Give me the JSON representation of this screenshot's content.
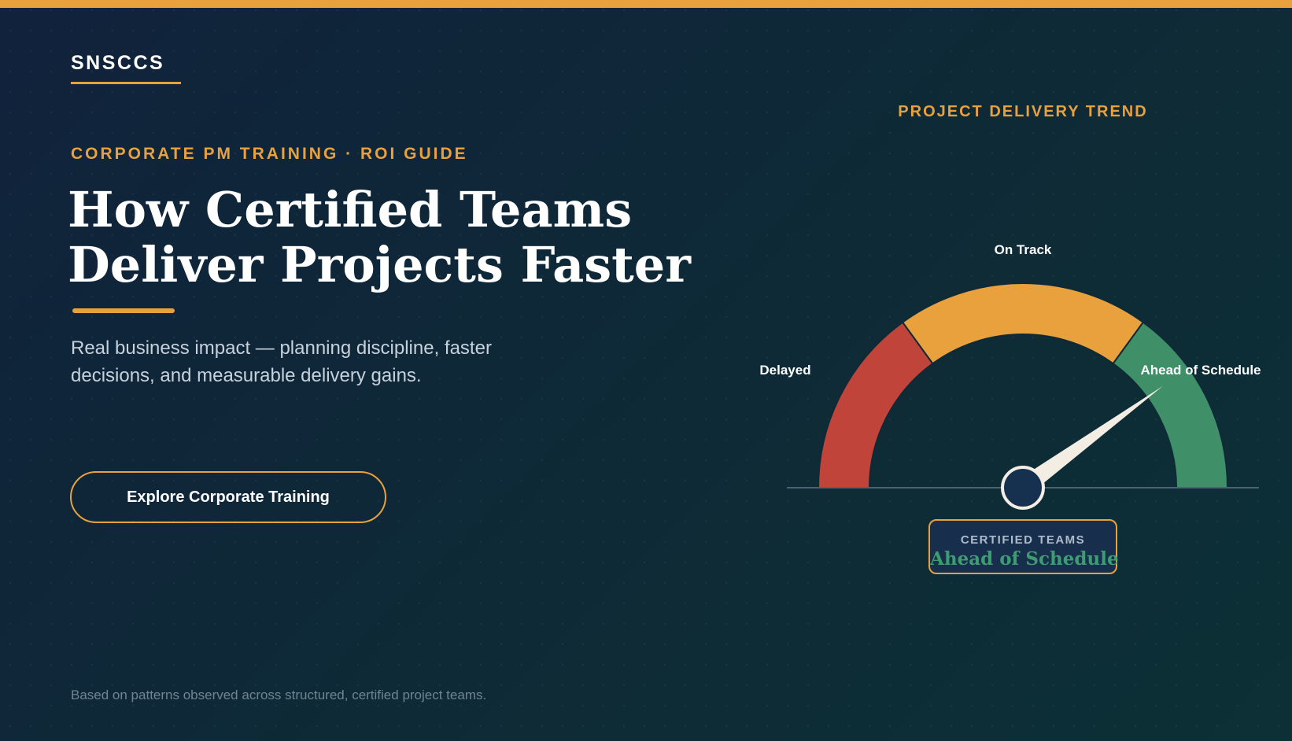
{
  "brand": "SNSCCS",
  "hero": {
    "eyebrow": "CORPORATE PM TRAINING · ROI GUIDE",
    "headline_line1": "How Certified Teams",
    "headline_line2": "Deliver Projects Faster",
    "subtext": "Real business impact — planning discipline, faster decisions, and measurable delivery gains.",
    "cta_label": "Explore Corporate Training"
  },
  "footnote": "Based on patterns observed across structured, certified project teams.",
  "gauge": {
    "title": "PROJECT DELIVERY TREND",
    "zones": [
      {
        "label": "Delayed",
        "color": "#c0443a"
      },
      {
        "label": "On Track",
        "color": "#e8a13d"
      },
      {
        "label": "Ahead of Schedule",
        "color": "#3f8f68"
      }
    ],
    "needle_fraction": 0.8,
    "readout_label": "CERTIFIED TEAMS",
    "readout_value": "Ahead of Schedule"
  },
  "colors": {
    "accent": "#e8a13d",
    "delayed": "#c0443a",
    "on_track": "#e8a13d",
    "ahead": "#3f8f68",
    "needle": "#f3ede4",
    "hub": "#16304f"
  }
}
